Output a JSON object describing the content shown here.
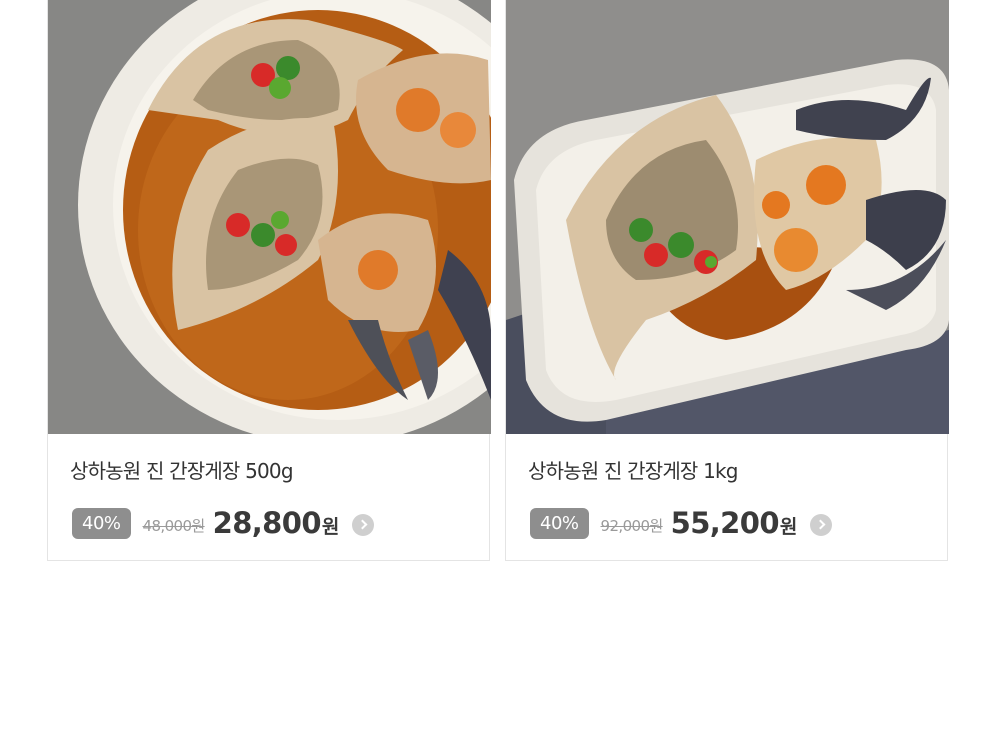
{
  "products": [
    {
      "title": "상하농원 진 간장게장 500g",
      "discount": "40%",
      "original_price": "48,000원",
      "sale_price": "28,800",
      "currency": "원",
      "image_alt": "soy-sauce-marinated-crab-round-plate"
    },
    {
      "title": "상하농원 진 간장게장 1kg",
      "discount": "40%",
      "original_price": "92,000원",
      "sale_price": "55,200",
      "currency": "원",
      "image_alt": "soy-sauce-marinated-crab-rectangular-plate"
    }
  ],
  "colors": {
    "badge_bg": "#8e8e8e",
    "price_text": "#3a3a3a",
    "strike_text": "#9a9a9a",
    "title_text": "#333333",
    "border": "#e4e4e4",
    "arrow_bg": "#cfcfcf"
  }
}
